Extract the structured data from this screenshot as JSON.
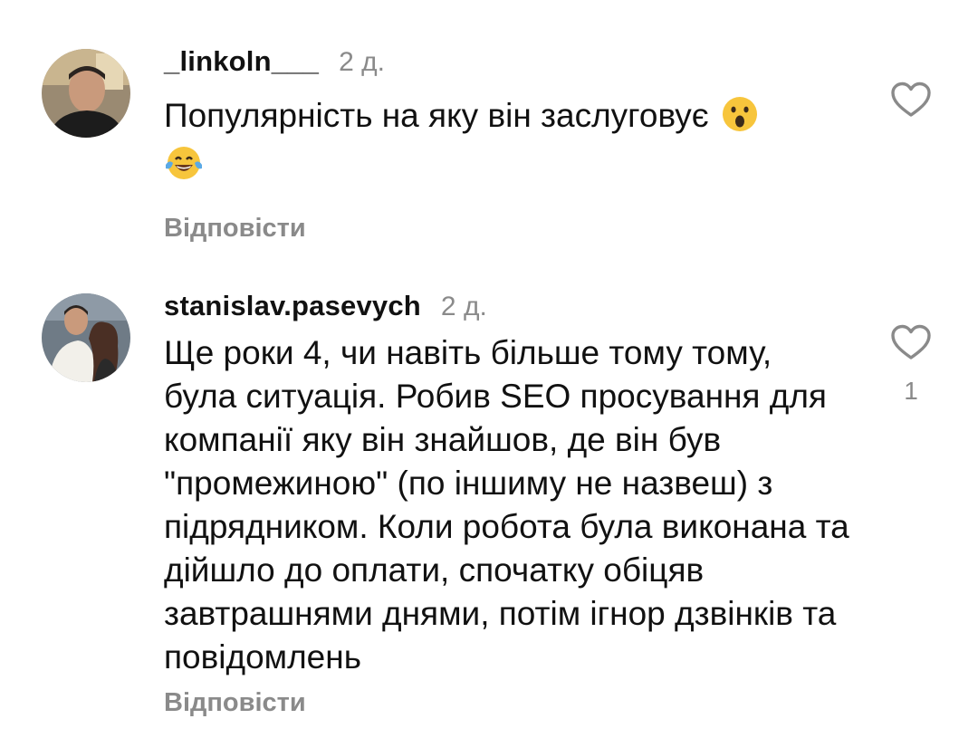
{
  "comments": [
    {
      "username": "_linkoln___",
      "time": "2 д.",
      "text": "Популярність на яку він заслуговує",
      "emojis": [
        "hushed-face-emoji",
        "tears-of-joy-emoji"
      ],
      "reply_label": "Відповісти",
      "like_icon": "heart-outline-icon",
      "likes": ""
    },
    {
      "username": "stanislav.pasevych",
      "time": "2 д.",
      "text": "Ще роки 4, чи навіть більше тому тому, була ситуація. Робив SEO просування для компанії яку він знайшов, де він був \"промежиною\" (по іншиму не назвеш) з підрядником. Коли робота була виконана та дійшло до оплати, спочатку обіцяв завтрашнями днями, потім ігнор дзвінків та повідомлень",
      "reply_label": "Відповісти",
      "like_icon": "heart-outline-icon",
      "likes": "1"
    }
  ],
  "colors": {
    "text": "#111111",
    "secondary": "#8a8a8a",
    "background": "#ffffff"
  }
}
